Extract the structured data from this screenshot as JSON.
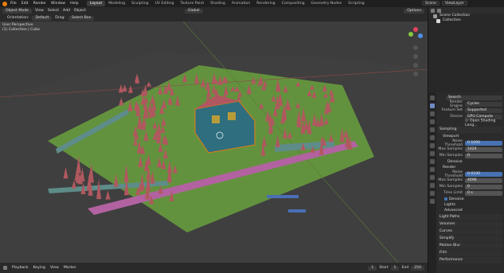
{
  "topbar": {
    "menus": [
      "File",
      "Edit",
      "Render",
      "Window",
      "Help"
    ],
    "workspaces": [
      "Layout",
      "Modeling",
      "Sculpting",
      "UV Editing",
      "Texture Paint",
      "Shading",
      "Animation",
      "Rendering",
      "Compositing",
      "Geometry Nodes",
      "Scripting"
    ],
    "active_workspace": "Layout",
    "scene": "Scene",
    "view_layer": "ViewLayer"
  },
  "header": {
    "mode": "Object Mode",
    "menus": [
      "View",
      "Select",
      "Add",
      "Object"
    ],
    "orientation_label": "Orientation:",
    "orientation": "Default",
    "drag_label": "Drag:",
    "drag": "Select Box",
    "transform": "Global",
    "options": "Options"
  },
  "viewport": {
    "line1": "User Perspective",
    "line2": "(1) Collection | Cube",
    "gizmo_axes": [
      "X",
      "Y",
      "Z"
    ]
  },
  "timeline": {
    "menus": [
      "Playback",
      "Keying",
      "View",
      "Marker"
    ],
    "current_frame": "1",
    "start_label": "Start",
    "start": "1",
    "end_label": "End",
    "end": "250"
  },
  "outliner": {
    "root": "Scene Collection",
    "items": [
      "Collection"
    ]
  },
  "properties": {
    "search_placeholder": "Search",
    "render_engine_label": "Render Engine",
    "render_engine": "Cycles",
    "feature_set_label": "Feature Set",
    "feature_set": "Supported",
    "device_label": "Device",
    "device": "GPU Compute",
    "open_shading": "Open Shading Lang...",
    "sampling": "Sampling",
    "viewport_section": "Viewport",
    "viewport_rows": [
      {
        "label": "Noise Threshold",
        "value": "0.1000"
      },
      {
        "label": "Max Samples",
        "value": "1024"
      },
      {
        "label": "Min Samples",
        "value": "0"
      }
    ],
    "denoise": "Denoise",
    "render_section": "Render",
    "render_rows": [
      {
        "label": "Noise Threshold",
        "value": "0.0100"
      },
      {
        "label": "Max Samples",
        "value": "4096"
      },
      {
        "label": "Min Samples",
        "value": "0"
      },
      {
        "label": "Time Limit",
        "value": "0 s"
      }
    ],
    "denoise2": "Denoise",
    "lights": "Lights",
    "advanced": "Advanced",
    "light_paths": "Light Paths",
    "volumes": "Volumes",
    "curves": "Curves",
    "simplify": "Simplify",
    "motion_blur": "Motion Blur",
    "film": "Film",
    "performance": "Performance"
  },
  "colors": {
    "accent": "#4772b3",
    "orange": "#e87d0d",
    "floor": "#63923e",
    "spike": "#b0585f",
    "fence": "#5e8c89",
    "path": "#b262a0",
    "house": "#2e6e7f"
  }
}
